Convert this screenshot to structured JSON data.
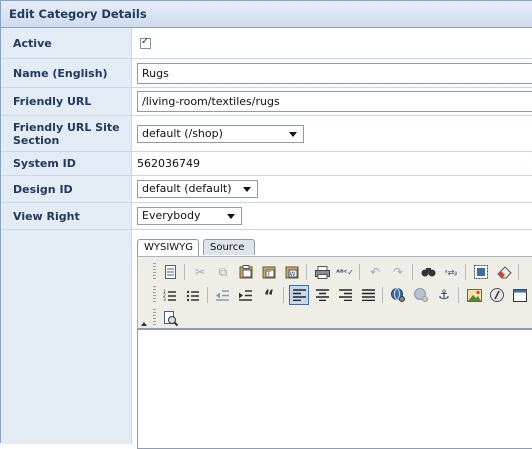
{
  "panel": {
    "title": "Edit Category Details"
  },
  "fields": {
    "active": {
      "label": "Active",
      "checked_glyph": "✓"
    },
    "name": {
      "label": "Name (English)",
      "value": "Rugs"
    },
    "friendly_url": {
      "label": "Friendly URL",
      "value": "/living-room/textiles/rugs"
    },
    "site_section": {
      "label": "Friendly URL Site Section",
      "selected": "default (/shop)"
    },
    "system_id": {
      "label": "System ID",
      "value": "562036749"
    },
    "design_id": {
      "label": "Design ID",
      "selected": "default (default)"
    },
    "view_right": {
      "label": "View Right",
      "selected": "Everybody"
    }
  },
  "editor": {
    "tabs": [
      {
        "label": "WYSIWYG",
        "active": true
      },
      {
        "label": "Source",
        "active": false
      }
    ],
    "toolbar_rows": [
      [
        "document-icon",
        "cut-icon",
        "copy-icon",
        "paste-icon",
        "paste-text-icon",
        "paste-word-icon",
        "print-icon",
        "spellcheck-icon",
        "undo-icon",
        "redo-icon",
        "find-icon",
        "replace-icon",
        "select-all-icon",
        "eraser-icon"
      ],
      [
        "numbered-list-icon",
        "bulleted-list-icon",
        "outdent-icon",
        "indent-icon",
        "blockquote-icon",
        "align-left-icon",
        "align-center-icon",
        "align-right-icon",
        "justify-icon",
        "link-icon",
        "unlink-icon",
        "anchor-icon",
        "image-icon",
        "flash-icon",
        "table-icon"
      ],
      [
        "preview-icon"
      ]
    ]
  }
}
